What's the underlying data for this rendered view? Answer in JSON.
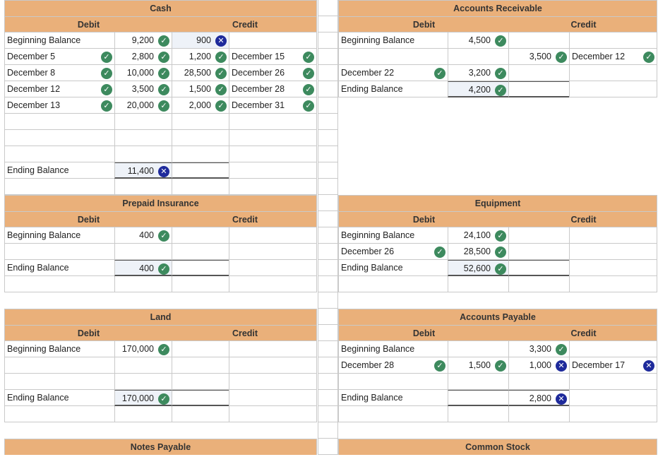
{
  "labels": {
    "debit": "Debit",
    "credit": "Credit"
  },
  "colors": {
    "header": "#eab07a",
    "check": "#3d8a5e",
    "cross": "#1e2a9b",
    "grid": "#c9c9c9"
  },
  "icons": {
    "correct": "check-circle-icon",
    "incorrect": "x-circle-icon"
  },
  "accounts": [
    {
      "name": "Cash",
      "rows": [
        [
          "Beginning Balance",
          "",
          "9,200",
          "900",
          "",
          ""
        ],
        [
          "December 5",
          "",
          "2,800",
          "1,200",
          "December 15",
          ""
        ],
        [
          "December 8",
          "",
          "10,000",
          "28,500",
          "December 26",
          ""
        ],
        [
          "December 12",
          "",
          "3,500",
          "1,500",
          "December 28",
          ""
        ],
        [
          "December 13",
          "",
          "20,000",
          "2,000",
          "December 31",
          ""
        ],
        [
          "",
          "",
          "",
          "",
          "",
          ""
        ],
        [
          "",
          "",
          "",
          "",
          "",
          ""
        ],
        [
          "",
          "",
          "",
          "",
          "",
          ""
        ],
        [
          "Ending Balance",
          "",
          "11,400",
          "",
          "",
          ""
        ],
        [
          "",
          "",
          "",
          "",
          "",
          ""
        ]
      ]
    },
    {
      "name": "Accounts Receivable",
      "rows": [
        [
          "Beginning Balance",
          "",
          "4,500",
          "",
          "",
          ""
        ],
        [
          "",
          "",
          "",
          "3,500",
          "December 12",
          ""
        ],
        [
          "December 22",
          "",
          "3,200",
          "",
          "",
          ""
        ],
        [
          "Ending Balance",
          "",
          "4,200",
          "",
          "",
          ""
        ]
      ]
    },
    {
      "name": "Prepaid Insurance",
      "rows": [
        [
          "Beginning Balance",
          "",
          "400",
          "",
          "",
          ""
        ],
        [
          "",
          "",
          "",
          "",
          "",
          ""
        ],
        [
          "Ending Balance",
          "",
          "400",
          "",
          "",
          ""
        ],
        [
          "",
          "",
          "",
          "",
          "",
          ""
        ]
      ]
    },
    {
      "name": "Equipment",
      "rows": [
        [
          "Beginning Balance",
          "",
          "24,100",
          "",
          "",
          ""
        ],
        [
          "December 26",
          "",
          "28,500",
          "",
          "",
          ""
        ],
        [
          "Ending Balance",
          "",
          "52,600",
          "",
          "",
          ""
        ],
        [
          "",
          "",
          "",
          "",
          "",
          ""
        ]
      ]
    },
    {
      "name": "Land",
      "rows": [
        [
          "Beginning Balance",
          "",
          "170,000",
          "",
          "",
          ""
        ],
        [
          "",
          "",
          "",
          "",
          "",
          ""
        ],
        [
          "",
          "",
          "",
          "",
          "",
          ""
        ],
        [
          "Ending Balance",
          "",
          "170,000",
          "",
          "",
          ""
        ],
        [
          "",
          "",
          "",
          "",
          "",
          ""
        ]
      ]
    },
    {
      "name": "Accounts Payable",
      "rows": [
        [
          "Beginning Balance",
          "",
          "",
          "3,300",
          "",
          ""
        ],
        [
          "December 28",
          "",
          "1,500",
          "1,000",
          "December 17",
          ""
        ],
        [
          "",
          "",
          "",
          "",
          "",
          ""
        ],
        [
          "Ending Balance",
          "",
          "",
          "2,800",
          "",
          ""
        ],
        [
          "",
          "",
          "",
          "",
          "",
          ""
        ]
      ]
    },
    {
      "name": "Notes Payable",
      "rows": []
    },
    {
      "name": "Common Stock",
      "rows": []
    }
  ],
  "marks": [
    [
      [
        "",
        "",
        "ok",
        "bad",
        "",
        ""
      ],
      [
        "",
        "ok",
        "ok",
        "ok",
        "",
        "ok"
      ],
      [
        "",
        "ok",
        "ok",
        "ok",
        "",
        "ok"
      ],
      [
        "",
        "ok",
        "ok",
        "ok",
        "",
        "ok"
      ],
      [
        "",
        "ok",
        "ok",
        "ok",
        "",
        "ok"
      ],
      [
        "",
        "",
        "",
        "",
        "",
        ""
      ],
      [
        "",
        "",
        "",
        "",
        "",
        ""
      ],
      [
        "",
        "",
        "",
        "",
        "",
        ""
      ],
      [
        "",
        "",
        "bad",
        "",
        "",
        ""
      ],
      [
        "",
        "",
        "",
        "",
        "",
        ""
      ]
    ],
    [
      [
        "",
        "",
        "ok",
        "",
        "",
        ""
      ],
      [
        "",
        "",
        "",
        "ok",
        "",
        "ok"
      ],
      [
        "",
        "ok",
        "ok",
        "",
        "",
        ""
      ],
      [
        "",
        "",
        "ok",
        "",
        "",
        ""
      ]
    ],
    [
      [
        "",
        "",
        "ok",
        "",
        "",
        ""
      ],
      [
        "",
        "",
        "",
        "",
        "",
        ""
      ],
      [
        "",
        "",
        "ok",
        "",
        "",
        ""
      ],
      [
        "",
        "",
        "",
        "",
        "",
        ""
      ]
    ],
    [
      [
        "",
        "",
        "ok",
        "",
        "",
        ""
      ],
      [
        "",
        "ok",
        "ok",
        "",
        "",
        ""
      ],
      [
        "",
        "",
        "ok",
        "",
        "",
        ""
      ],
      [
        "",
        "",
        "",
        "",
        "",
        ""
      ]
    ],
    [
      [
        "",
        "",
        "ok",
        "",
        "",
        ""
      ],
      [
        "",
        "",
        "",
        "",
        "",
        ""
      ],
      [
        "",
        "",
        "",
        "",
        "",
        ""
      ],
      [
        "",
        "",
        "ok",
        "",
        "",
        ""
      ],
      [
        "",
        "",
        "",
        "",
        "",
        ""
      ]
    ],
    [
      [
        "",
        "",
        "",
        "ok",
        "",
        ""
      ],
      [
        "",
        "ok",
        "ok",
        "bad",
        "",
        "bad"
      ],
      [
        "",
        "",
        "",
        "",
        "",
        ""
      ],
      [
        "",
        "",
        "",
        "bad",
        "",
        ""
      ],
      [
        "",
        "",
        "",
        "",
        "",
        ""
      ]
    ],
    [],
    []
  ]
}
